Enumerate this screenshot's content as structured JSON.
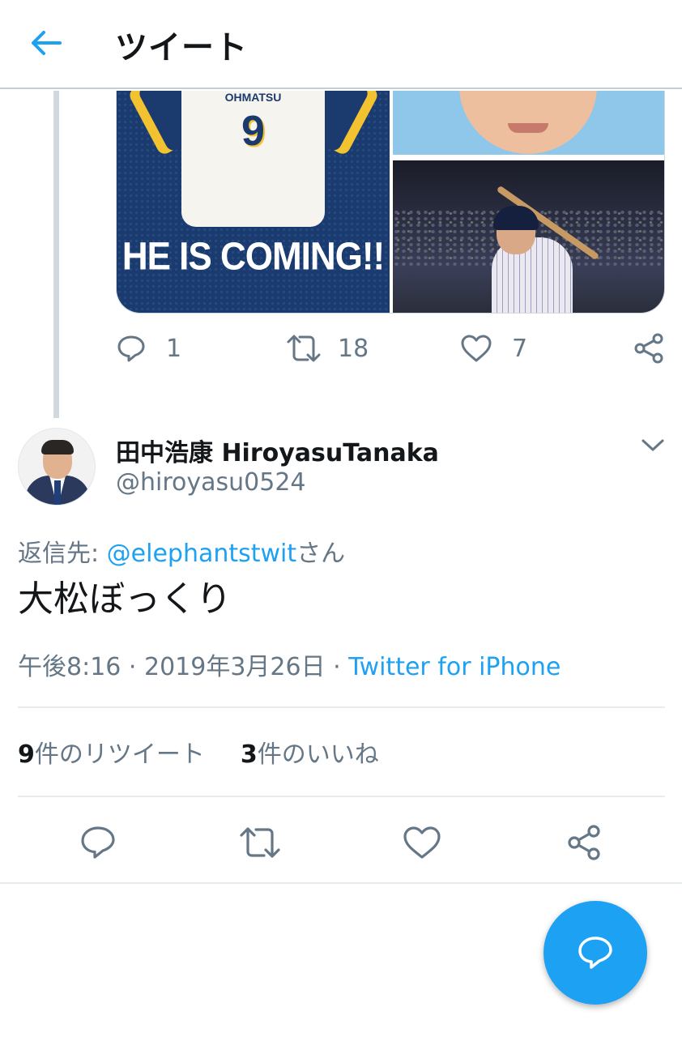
{
  "header": {
    "title": "ツイート",
    "back_icon": "arrow-left-icon"
  },
  "previous_tweet": {
    "media": {
      "jersey_name": "OHMATSU",
      "jersey_number": "9",
      "slogan": "HE IS COMING!!"
    },
    "actions": {
      "reply_count": "1",
      "retweet_count": "18",
      "like_count": "7"
    }
  },
  "tweet": {
    "author_name": "田中浩康 HiroyasuTanaka",
    "author_handle": "@hiroyasu0524",
    "reply_prefix": "返信先: ",
    "reply_user": "@elephantstwit",
    "reply_suffix": "さん",
    "text": "大松ぼっくり",
    "time": "午後8:16 · 2019年3月26日 · ",
    "source": "Twitter for iPhone"
  },
  "stats": {
    "retweets_count": "9",
    "retweets_label": "件のリツイート",
    "likes_count": "3",
    "likes_label": "件のいいね"
  },
  "colors": {
    "accent": "#1da1f2",
    "secondary_text": "#657786",
    "primary_text": "#14171a",
    "divider": "#e6ecf0"
  }
}
